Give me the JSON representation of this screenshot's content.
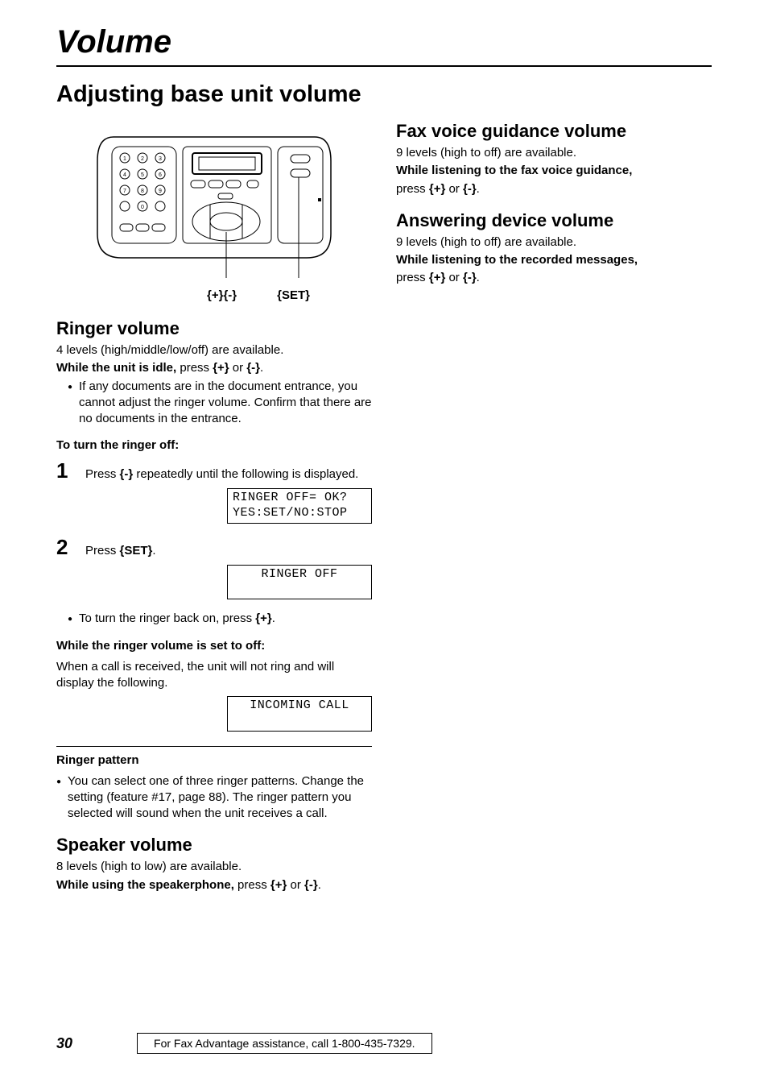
{
  "title": "Volume",
  "main_heading": "Adjusting base unit volume",
  "diagram_labels": {
    "plusminus": "{+}{-}",
    "set": "{SET}"
  },
  "ringer": {
    "heading": "Ringer volume",
    "levels": "4 levels (high/middle/low/off) are available.",
    "idle_bold": "While the unit is idle,",
    "idle_rest": " press ",
    "idle_end": ".",
    "bullet1": "If any documents are in the document entrance, you cannot adjust the ringer volume. Confirm that there are no documents in the entrance.",
    "turn_off_head": "To turn the ringer off:",
    "step1_a": "Press ",
    "step1_b": " repeatedly until the following is displayed.",
    "display1_l1": "RINGER OFF= OK?",
    "display1_l2": "YES:SET/NO:STOP",
    "step2_a": "Press ",
    "step2_b": ".",
    "display2": "RINGER OFF",
    "back_on_a": "To turn the ringer back on, press ",
    "back_on_b": ".",
    "off_head": "While the ringer volume is set to off:",
    "off_text": "When a call is received, the unit will not ring and will display the following.",
    "display3": "INCOMING CALL",
    "pattern_head": "Ringer pattern",
    "pattern_bullet": "You can select one of three ringer patterns. Change the setting (feature #17, page 88). The ringer pattern you selected will sound when the unit receives a call."
  },
  "speaker": {
    "heading": "Speaker volume",
    "levels": "8 levels (high to low) are available.",
    "bold": "While using the speakerphone,",
    "rest_a": " press ",
    "rest_b": " or ",
    "rest_c": "."
  },
  "fax": {
    "heading": "Fax voice guidance volume",
    "levels": "9 levels (high to off) are available.",
    "bold": "While listening to the fax voice guidance,",
    "press_a": "press ",
    "press_b": " or ",
    "press_c": "."
  },
  "ans": {
    "heading": "Answering device volume",
    "levels": "9 levels (high to off) are available.",
    "bold": "While listening to the recorded messages,",
    "press_a": "press ",
    "press_b": " or ",
    "press_c": "."
  },
  "keys": {
    "plus": "{+}",
    "minus": "{-}",
    "set": "{SET}",
    "or": " or "
  },
  "footer": {
    "page": "30",
    "text": "For Fax Advantage assistance, call 1-800-435-7329."
  }
}
